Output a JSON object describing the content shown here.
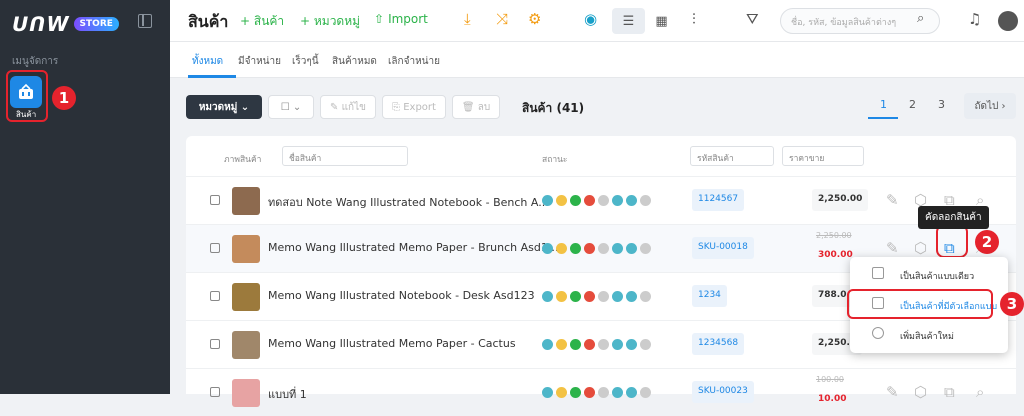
{
  "brand": {
    "logo_text": "ᑌᑎW",
    "store_badge": "STORE"
  },
  "sidebar": {
    "heading": "เมนูจัดการ",
    "items": [
      {
        "label": "สินค้า",
        "icon": "basket-icon"
      }
    ]
  },
  "header": {
    "title": "สินค้า",
    "add_product": "+ สินค้า",
    "add_category": "+ หมวดหมู่",
    "import": "Import",
    "search_placeholder": "ชื่อ, รหัส, ข้อมูลสินค้าต่างๆ"
  },
  "tabs": [
    "ทั้งหมด",
    "มีจำหน่าย",
    "เร็วๆนี้",
    "สินค้าหมด",
    "เลิกจำหน่าย"
  ],
  "toolbar": {
    "category_btn": "หมวดหมู่",
    "edit": "แก้ไข",
    "export": "Export",
    "delete": "ลบ",
    "count_label": "สินค้า (41)"
  },
  "pagination": {
    "pages": [
      "1",
      "2",
      "3"
    ],
    "next": "ถัดไป ›"
  },
  "table": {
    "headers": {
      "image": "ภาพสินค้า",
      "name": "ชื่อสินค้า",
      "status": "สถานะ",
      "sku": "รหัสสินค้า",
      "price": "ราคาขาย"
    },
    "rows": [
      {
        "name": "ทดสอบ Note Wang Illustrated Notebook - Bench A...",
        "sku": "1124567",
        "price": "2,250.00",
        "old_price": "",
        "thumb": "#8d6a4f"
      },
      {
        "name": "Memo Wang Illustrated Memo Paper - Brunch Asd1...",
        "sku": "SKU-00018",
        "price": "300.00",
        "old_price": "2,250.00",
        "thumb": "#c48b5c"
      },
      {
        "name": "Memo Wang Illustrated Notebook - Desk Asd123",
        "sku": "1234",
        "price": "788.0",
        "old_price": "",
        "thumb": "#9c7a3c"
      },
      {
        "name": "Memo Wang Illustrated Memo Paper - Cactus",
        "sku": "1234568",
        "price": "2,250.0",
        "old_price": "",
        "thumb": "#a0876a"
      },
      {
        "name": "แบบที่ 1",
        "sku": "SKU-00023",
        "price": "10.00",
        "old_price": "100.00",
        "thumb": "#e7a3a3"
      }
    ]
  },
  "tooltip": "คัดลอกสินค้า",
  "copy_menu": [
    "เป็นสินค้าแบบเดียว",
    "เป็นสินค้าที่มีตัวเลือกแบบ",
    "เพิ่มสินค้าใหม่"
  ],
  "badges": [
    "1",
    "2",
    "3"
  ],
  "colors": {
    "accent": "#1e88e5",
    "highlight": "#e5232d",
    "sidebar": "#2a3038"
  }
}
